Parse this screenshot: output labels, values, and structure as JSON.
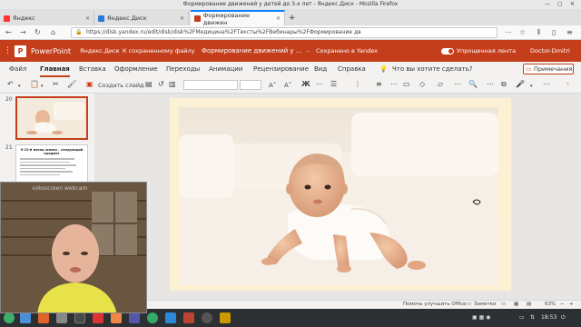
{
  "window": {
    "title": "Формирование движений у детей до 3-х лет - Яндекс.Диск - Mozilla Firefox"
  },
  "tabs": [
    {
      "label": "Яндекс",
      "favicon_color": "#ff3333"
    },
    {
      "label": "Яндекс.Диск",
      "favicon_color": "#2a7bd5"
    },
    {
      "label": "Формирование движен",
      "favicon_color": "#c43e1c"
    }
  ],
  "nav": {
    "url": "https://disk.yandex.ru/edit/disk/disk%2FМедицина%2FТексты%2FВебинары%2FФормирование дв"
  },
  "ppt_header": {
    "app_name": "PowerPoint",
    "breadcrumb_disk": "Яндекс.Диск",
    "breadcrumb_back": "К сохраненному файлу",
    "doc_title": "Формирование движений у ...",
    "save_status": "Сохранено в Yandex",
    "simplified_ribbon": "Упрощенная лента",
    "user": "Doctor-Dmitri"
  },
  "ribbon": {
    "tabs": [
      "Файл",
      "Главная",
      "Вставка",
      "Оформление",
      "Переходы",
      "Анимации",
      "Рецензирование",
      "Вид",
      "Справка"
    ],
    "active_tab": "Главная",
    "tell_me": "Что вы хотите сделать?",
    "comments": "Примечания"
  },
  "toolbar": {
    "new_slide": "Создать слайд"
  },
  "thumbnails": [
    {
      "number": "20"
    },
    {
      "number": "21",
      "title": "9-12-й месяц жизни – следующий предмет"
    }
  ],
  "webcam": {
    "label": "vokoscreen webcam"
  },
  "statusbar": {
    "help": "Помочь улучшить Office",
    "notes": "Заметки",
    "zoom": "63%"
  },
  "taskbar": {
    "time": "18:53"
  },
  "colors": {
    "ppt_red": "#c43e1c",
    "firefox_blue": "#0a84ff",
    "slide_border": "#fdf1d3"
  }
}
